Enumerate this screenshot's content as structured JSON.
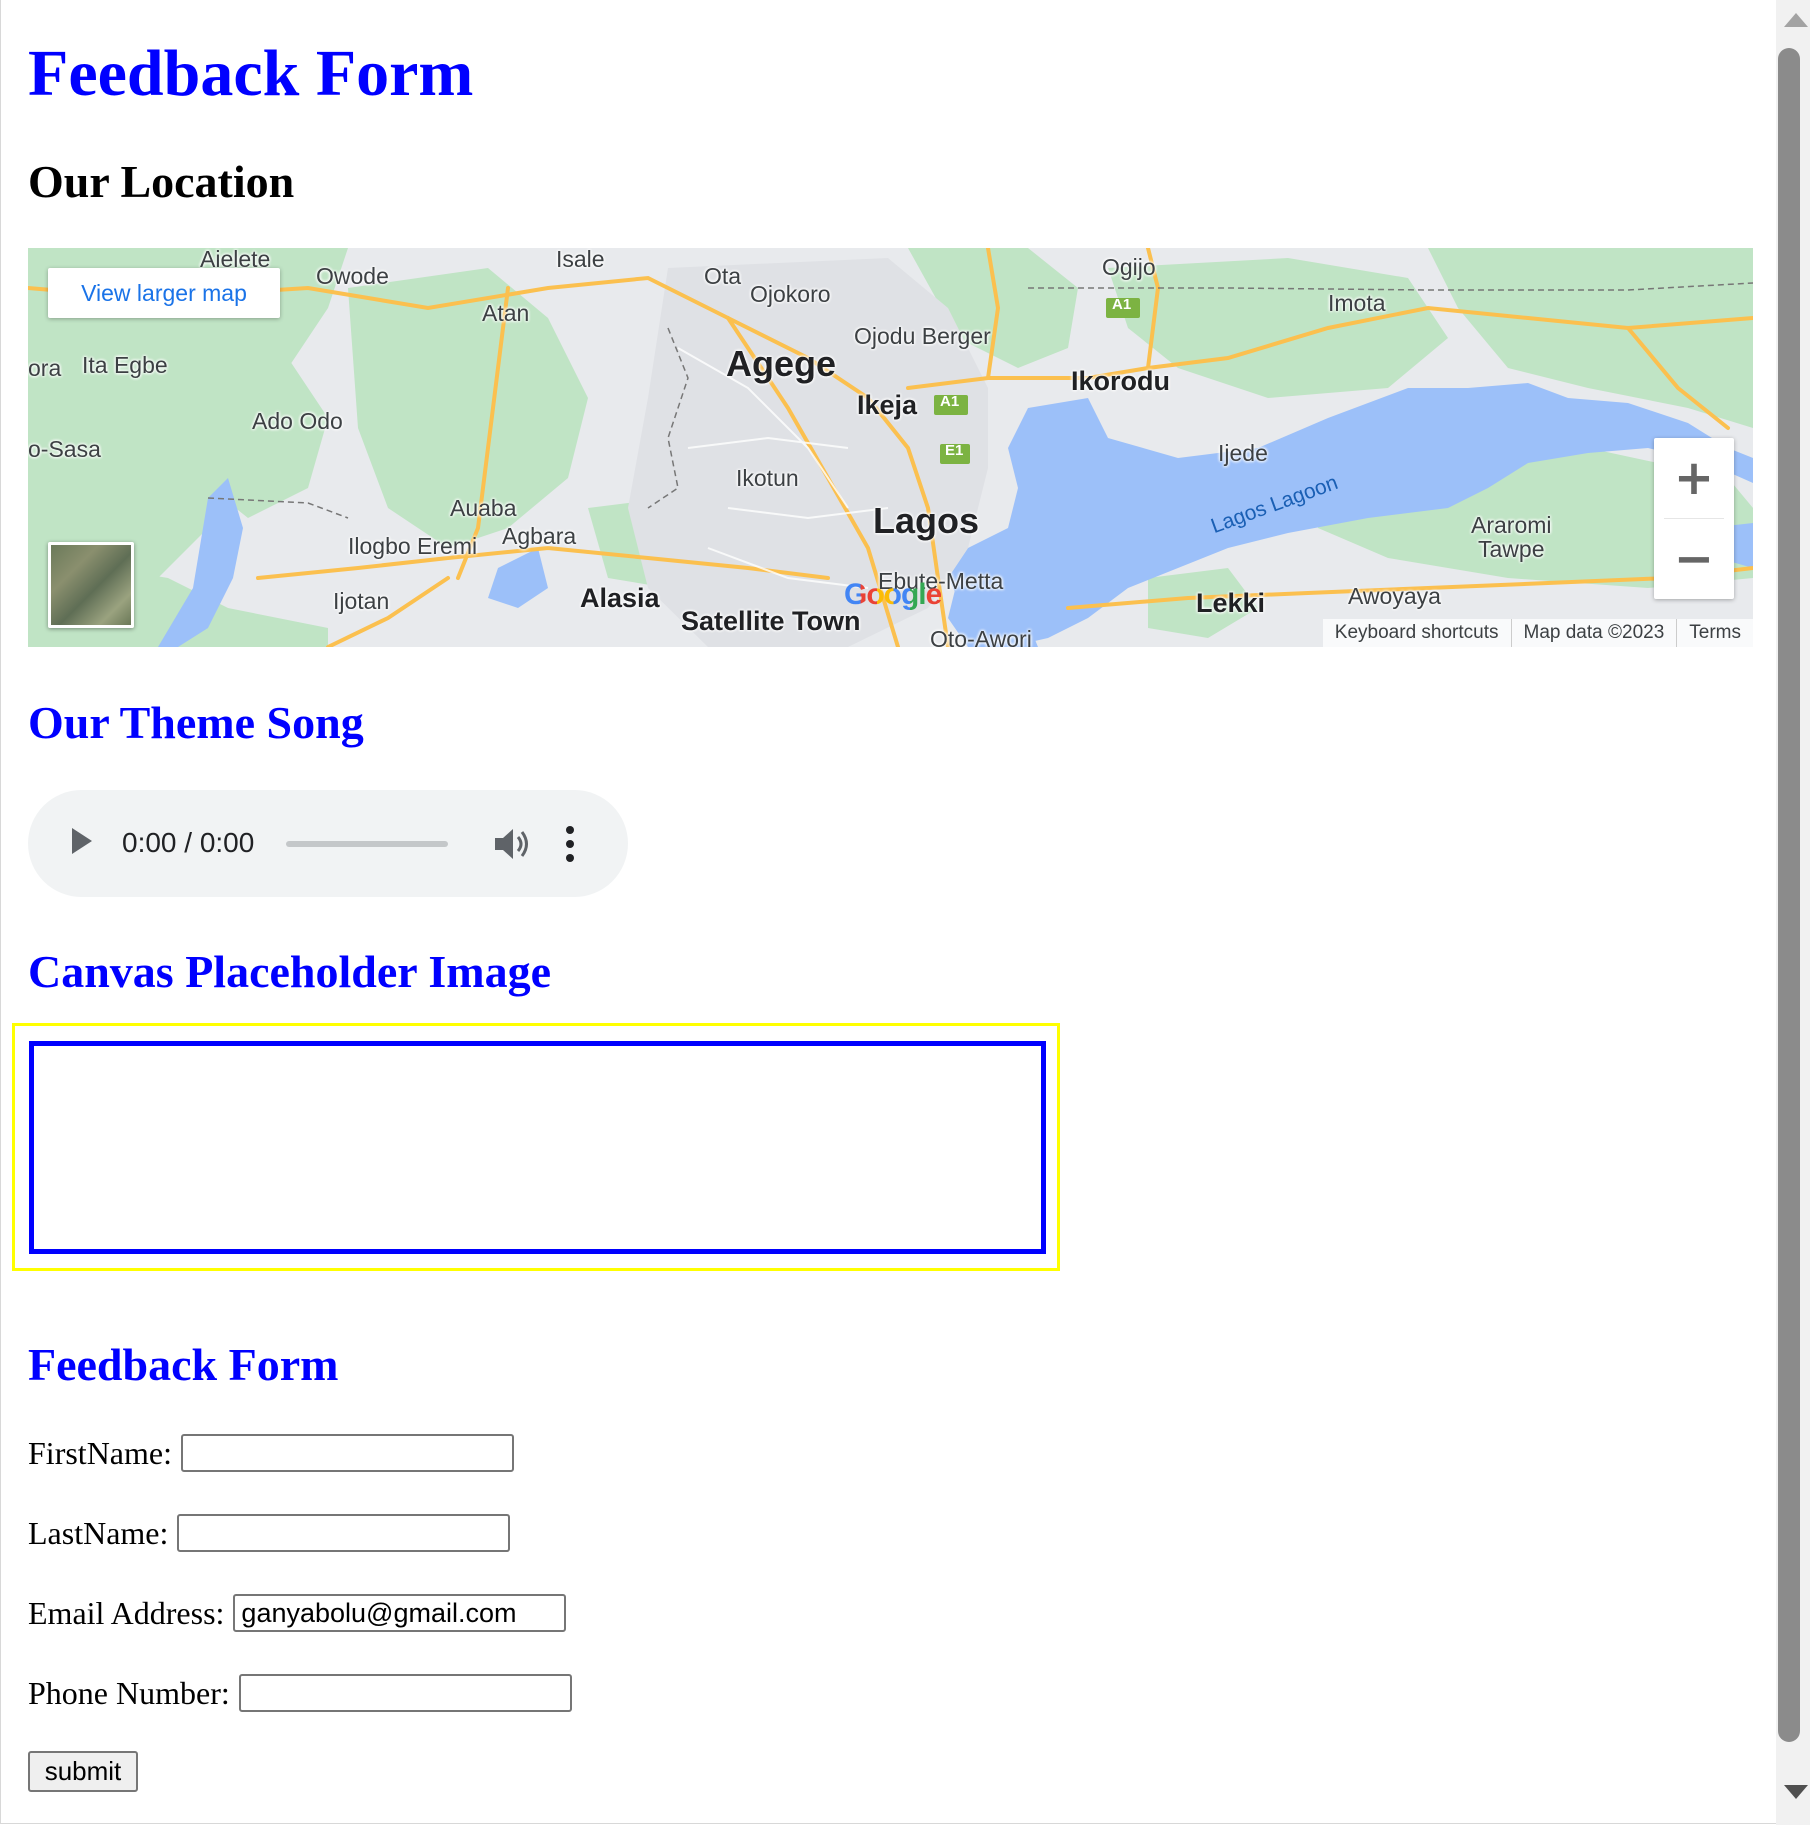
{
  "page": {
    "title": "Feedback Form"
  },
  "location": {
    "heading": "Our Location",
    "view_larger_map": "View larger map",
    "zoom_in": "+",
    "zoom_out": "−",
    "google_logo": "Google",
    "attribution": {
      "shortcuts": "Keyboard shortcuts",
      "map_data": "Map data ©2023",
      "terms": "Terms"
    },
    "places": [
      "Aielete",
      "Owode",
      "Isale",
      "Ota",
      "Ojokoro",
      "Ogijo",
      "Imota",
      "Atan",
      "ora",
      "Ita Egbe",
      "Agege",
      "Ojodu Berger",
      "Ikorodu",
      "Ikeja",
      "Ado Odo",
      "o-Sasa",
      "Ikotun",
      "Ijede",
      "Lagos",
      "Auaba",
      "Agbara",
      "Ilogbo Eremi",
      "Araromi",
      "Tawpe",
      "Ijotan",
      "Alasia",
      "Satellite Town",
      "Ebute-Metta",
      "Lekki",
      "Awoyaya",
      "Oto-Awori"
    ],
    "water": "Lagos Lagoon",
    "road_shields": [
      "A1",
      "A1",
      "E1"
    ]
  },
  "song": {
    "heading": "Our Theme Song",
    "time": "0:00 / 0:00"
  },
  "canvas": {
    "heading": "Canvas Placeholder Image"
  },
  "form": {
    "heading": "Feedback Form",
    "first_name_label": "FirstName:",
    "first_name_value": "",
    "last_name_label": "LastName:",
    "last_name_value": "",
    "email_label": "Email Address:",
    "email_value": "ganyabolu@gmail.com",
    "phone_label": "Phone Number:",
    "phone_value": "",
    "submit_label": "submit"
  },
  "colors": {
    "heading_blue": "#0000ff",
    "canvas_border": "#0000ff",
    "canvas_outline": "#ffff00",
    "map_water": "#9cc0f9",
    "map_park": "#c0e4c5",
    "map_road": "#fbc04f"
  }
}
